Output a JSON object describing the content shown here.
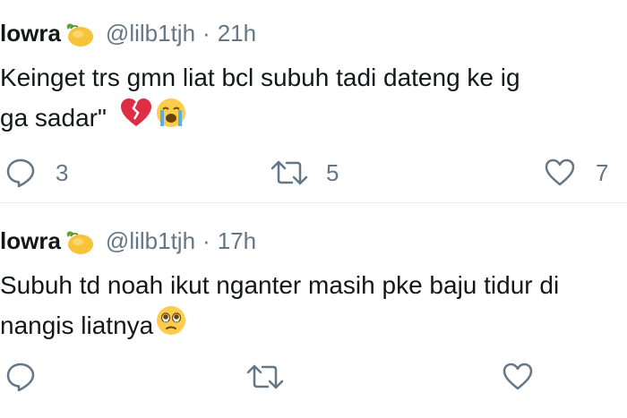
{
  "tweets": [
    {
      "name": "lowra",
      "handle": "@lilb1tjh",
      "separator": "·",
      "time": "21h",
      "text_line1": "Keinget trs gmn liat bcl subuh tadi dateng ke ig",
      "text_line2": "ga sadar\"",
      "emojis": [
        "broken-heart",
        "loudly-crying-face"
      ],
      "replies": "3",
      "retweets": "5",
      "likes": "7"
    },
    {
      "name": "lowra",
      "handle": "@lilb1tjh",
      "separator": "·",
      "time": "17h",
      "text_line1": "Subuh td noah ikut nganter masih pke baju tidur di",
      "text_line2": "nangis liatnya",
      "emojis": [
        "face-holding-back-tears"
      ],
      "replies": "",
      "retweets": "",
      "likes": ""
    }
  ],
  "icons": {
    "name_emoji": "mango-icon",
    "reply": "reply-icon",
    "retweet": "retweet-icon",
    "like": "like-icon"
  },
  "colors": {
    "text": "#14171a",
    "secondary": "#657786",
    "divider": "#e6ecf0"
  }
}
